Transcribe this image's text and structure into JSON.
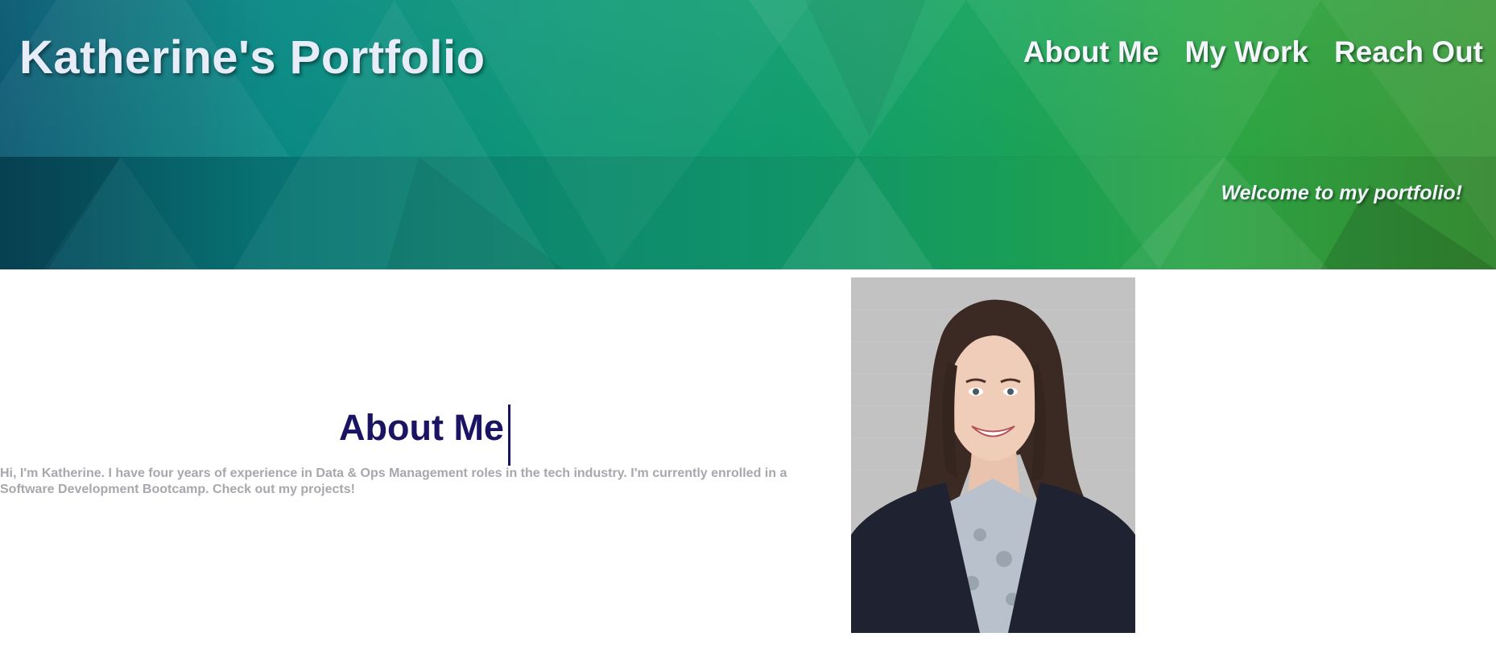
{
  "header": {
    "site_title": "Katherine's Portfolio",
    "welcome": "Welcome to my portfolio!",
    "nav": [
      {
        "label": "About Me"
      },
      {
        "label": "My Work"
      },
      {
        "label": "Reach Out"
      }
    ]
  },
  "about": {
    "heading": "About Me",
    "text": "Hi, I'm Katherine. I have four years of experience in Data & Ops Management roles in the tech industry. I'm currently enrolled in a Software Development Bootcamp. Check out my projects!"
  },
  "colors": {
    "heading": "#1b1463",
    "body_text": "#a7a7ad",
    "nav_text": "#f3f6fb",
    "banner_start": "#0a5a73",
    "banner_end": "#3e9a3a"
  },
  "icons": {
    "portrait": "profile-photo"
  }
}
